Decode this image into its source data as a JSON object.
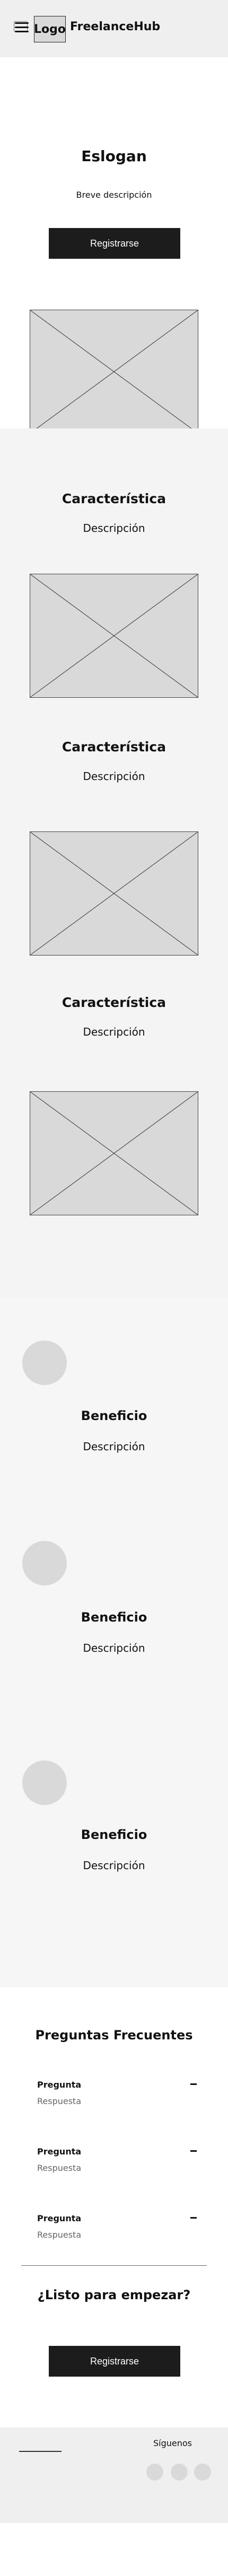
{
  "header": {
    "logo_text": "Logo",
    "brand_name": "FreelanceHub"
  },
  "hero": {
    "title": "Eslogan",
    "description": "Breve descripción",
    "button_label": "Registrarse"
  },
  "features": [
    {
      "title": "Característica",
      "description": "Descripción"
    },
    {
      "title": "Característica",
      "description": "Descripción"
    },
    {
      "title": "Característica",
      "description": "Descripción"
    }
  ],
  "benefits": [
    {
      "title": "Beneficio",
      "description": "Descripción"
    },
    {
      "title": "Beneficio",
      "description": "Descripción"
    },
    {
      "title": "Beneficio",
      "description": "Descripción"
    }
  ],
  "faq": {
    "title": "Preguntas Frecuentes",
    "items": [
      {
        "question": "Pregunta",
        "answer": "Respuesta"
      },
      {
        "question": "Pregunta",
        "answer": "Respuesta"
      },
      {
        "question": "Pregunta",
        "answer": "Respuesta"
      }
    ]
  },
  "cta": {
    "title": "¿Listo para empezar?",
    "button_label": "Registrarse"
  },
  "footer": {
    "follow_label": "Síguenos"
  },
  "icons": {
    "menu": "hamburger-menu-icon",
    "placeholder": "image-placeholder-icon",
    "faq_toggle": "minus-icon",
    "social": "social-icon"
  },
  "colors": {
    "button_bg": "#1c1c1c",
    "placeholder_gray": "#d9d9d9",
    "section_gray": "#f4f4f4"
  }
}
